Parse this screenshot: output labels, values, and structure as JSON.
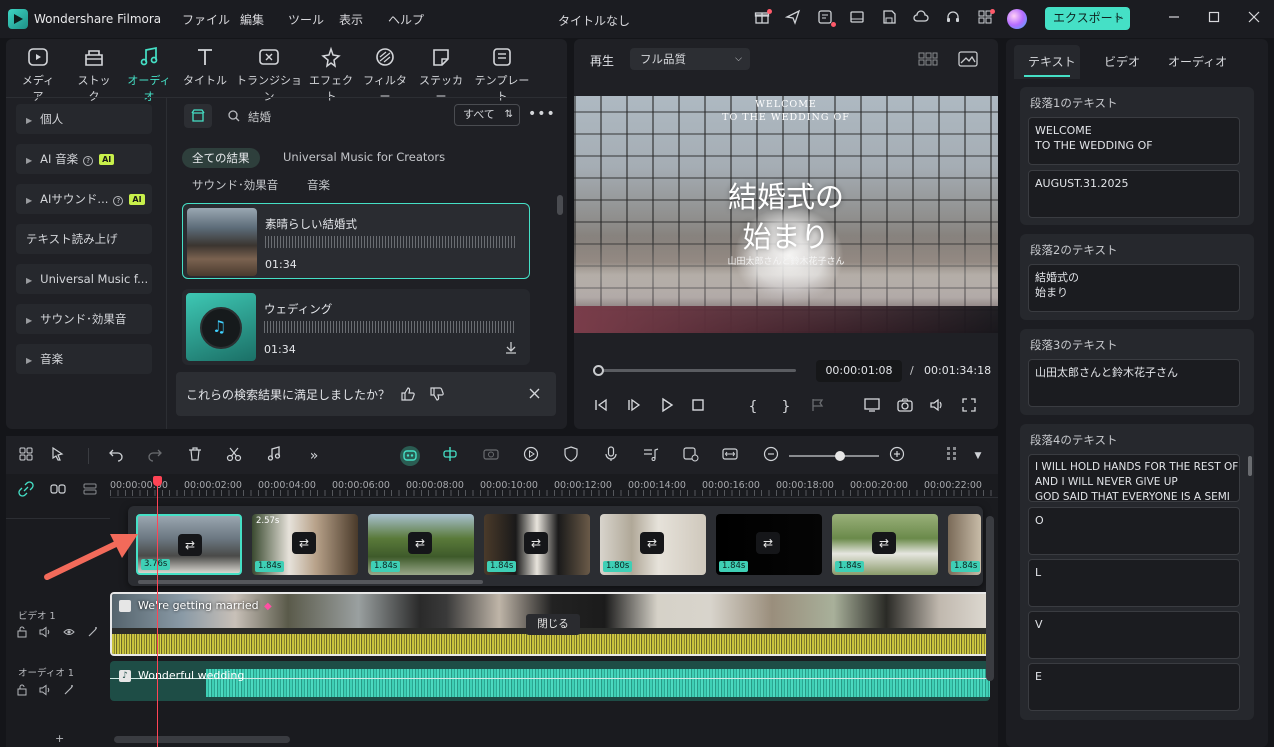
{
  "app": {
    "name": "Wondershare Filmora",
    "title": "タイトルなし",
    "export_label": "エクスポート"
  },
  "menu": [
    "ファイル",
    "編集",
    "ツール",
    "表示",
    "ヘルプ"
  ],
  "toolbar": [
    {
      "label": "メディア",
      "icon": "media-icon"
    },
    {
      "label": "ストック",
      "icon": "stock-icon"
    },
    {
      "label": "オーディオ",
      "icon": "audio-icon"
    },
    {
      "label": "タイトル",
      "icon": "title-icon"
    },
    {
      "label": "トランジション",
      "icon": "transition-icon"
    },
    {
      "label": "エフェクト",
      "icon": "effect-icon"
    },
    {
      "label": "フィルター",
      "icon": "filter-icon"
    },
    {
      "label": "ステッカー",
      "icon": "sticker-icon"
    },
    {
      "label": "テンプレート",
      "icon": "template-icon"
    }
  ],
  "sidebar": [
    {
      "label": "個人",
      "caret": true
    },
    {
      "label": "AI 音楽",
      "caret": true,
      "ai": "AI"
    },
    {
      "label": "AIサウンド...",
      "caret": true,
      "ai": "AI"
    },
    {
      "label": "テキスト読み上げ",
      "caret": false
    },
    {
      "label": "Universal Music f...",
      "caret": true
    },
    {
      "label": "サウンド･効果音",
      "caret": true
    },
    {
      "label": "音楽",
      "caret": true
    }
  ],
  "search": {
    "query": "結婚",
    "filter_label": "すべて"
  },
  "chips": {
    "row1": [
      "全ての結果",
      "Universal Music for Creators"
    ],
    "row2": [
      "サウンド･効果音",
      "音楽"
    ]
  },
  "results": [
    {
      "title": "素晴らしい結婚式",
      "duration": "01:34"
    },
    {
      "title": "ウェディング",
      "duration": "01:34"
    }
  ],
  "feedback": {
    "question": "これらの検索結果に満足しましたか？"
  },
  "preview": {
    "play_label": "再生",
    "quality": "フル品質",
    "video_text1": "WELCOME",
    "video_text2": "TO THE WEDDING OF",
    "video_title1": "結婚式の",
    "video_title2": "始まり",
    "video_sub": "山田太郎さんと鈴木花子さん",
    "current_time": "00:00:01:08",
    "separator": "/",
    "total_time": "00:01:34:18",
    "progress": 0.01
  },
  "right_panel": {
    "tabs": [
      "テキスト",
      "ビデオ",
      "オーディオ"
    ],
    "sections": [
      {
        "title": "段落1のテキスト",
        "boxes": [
          "WELCOME\nTO THE WEDDING OF",
          "AUGUST.31.2025"
        ]
      },
      {
        "title": "段落2のテキスト",
        "boxes": [
          "結婚式の\n始まり"
        ]
      },
      {
        "title": "段落3のテキスト",
        "boxes": [
          "山田太郎さんと鈴木花子さん"
        ]
      },
      {
        "title": "段落4のテキスト",
        "boxes": [
          "I WILL HOLD HANDS FOR THE REST OF\nAND I WILL NEVER GIVE UP\nGOD SAID THAT EVERYONE IS A SEMI",
          "O",
          "L",
          "V",
          "E"
        ]
      }
    ]
  },
  "timeline": {
    "ticks": [
      "00:00:00:00",
      "00:00:02:00",
      "00:00:04:00",
      "00:00:06:00",
      "00:00:08:00",
      "00:00:10:00",
      "00:00:12:00",
      "00:00:14:00",
      "00:00:16:00",
      "00:00:18:00",
      "00:00:20:00",
      "00:00:22:00"
    ],
    "clips": [
      "3.76s",
      "1.84s",
      "1.84s",
      "1.84s",
      "1.80s",
      "1.84s",
      "1.84s",
      "1.84s"
    ],
    "clip_overlay_label": "2.57s",
    "video_track_label": "ビデオ 1",
    "video_clip_title": "We're getting married",
    "audio_track_label": "オーディオ 1",
    "audio_clip_title": "Wonderful wedding",
    "close_tooltip": "閉じる"
  }
}
